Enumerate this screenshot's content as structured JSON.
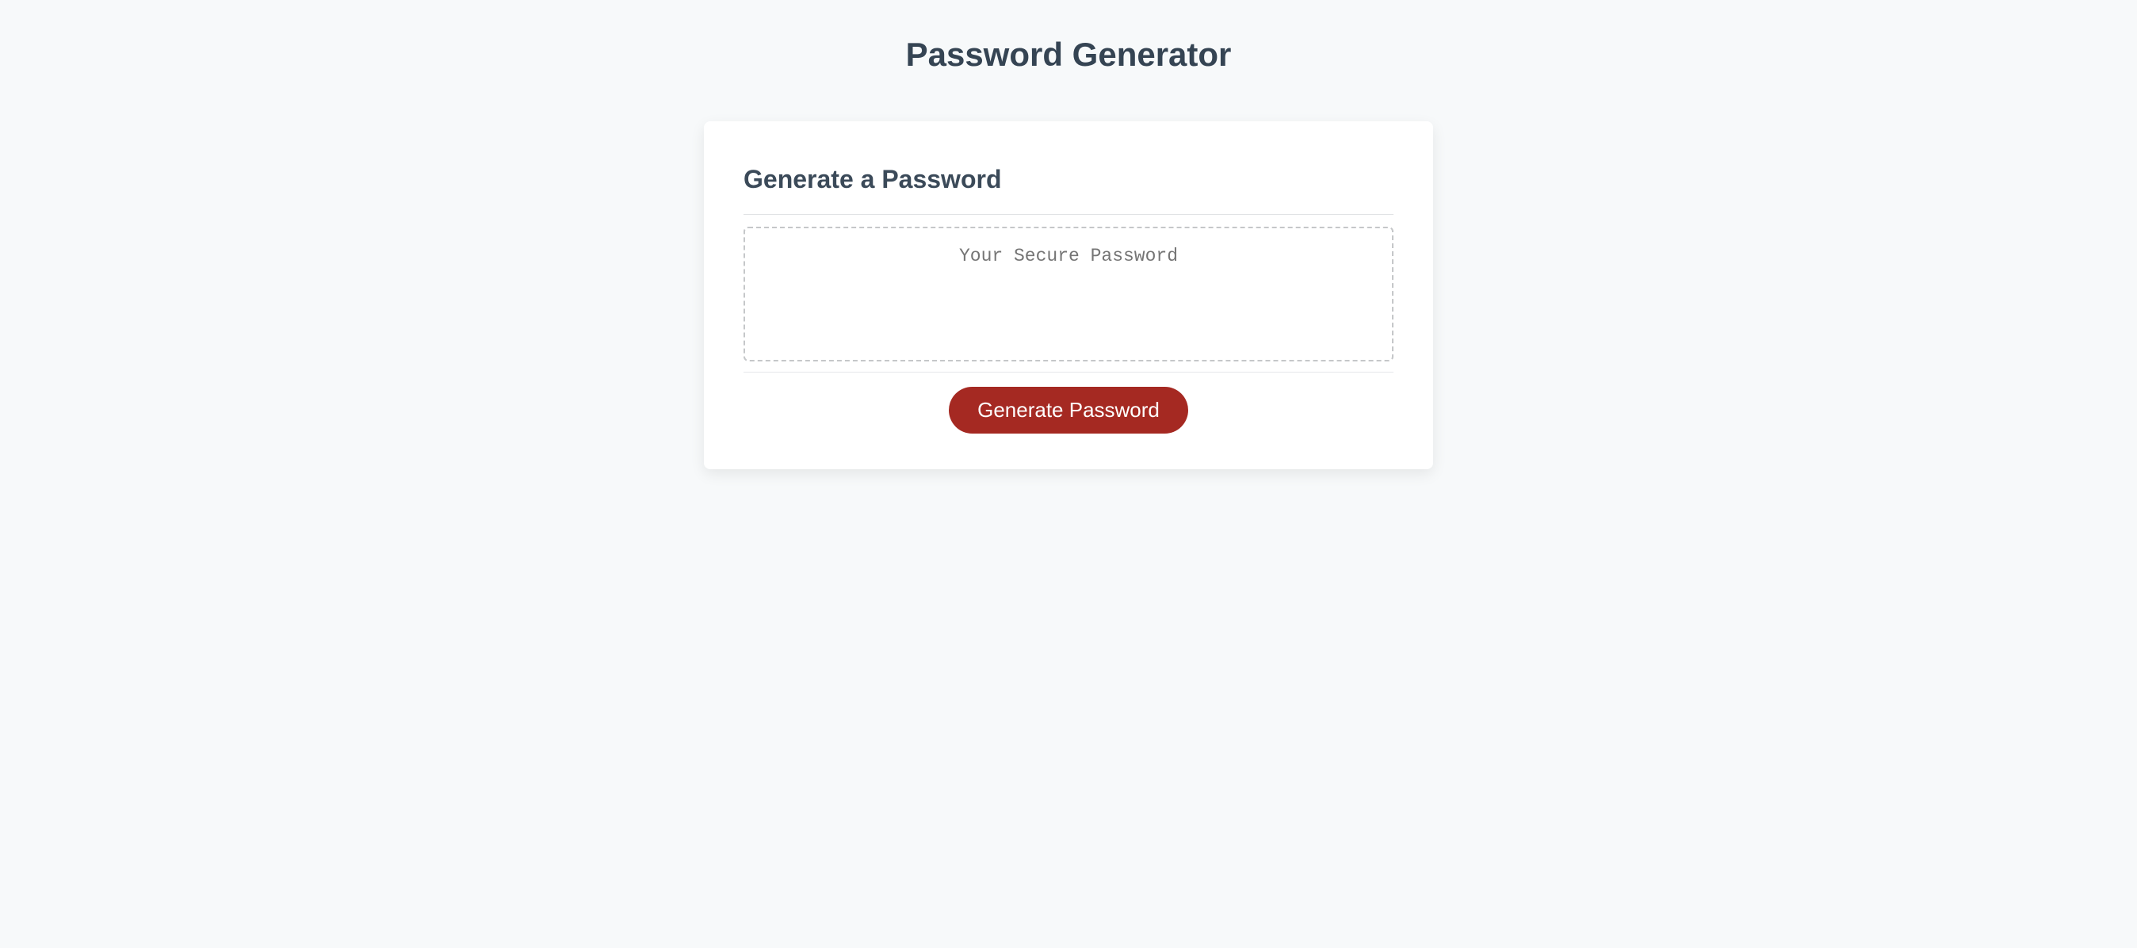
{
  "header": {
    "title": "Password Generator"
  },
  "card": {
    "title": "Generate a Password",
    "output_placeholder": "Your Secure Password",
    "output_value": "",
    "generate_button_label": "Generate Password"
  },
  "colors": {
    "accent": "#a52922",
    "background": "#f7f9fa",
    "card_bg": "#ffffff",
    "heading_text": "#354453"
  }
}
